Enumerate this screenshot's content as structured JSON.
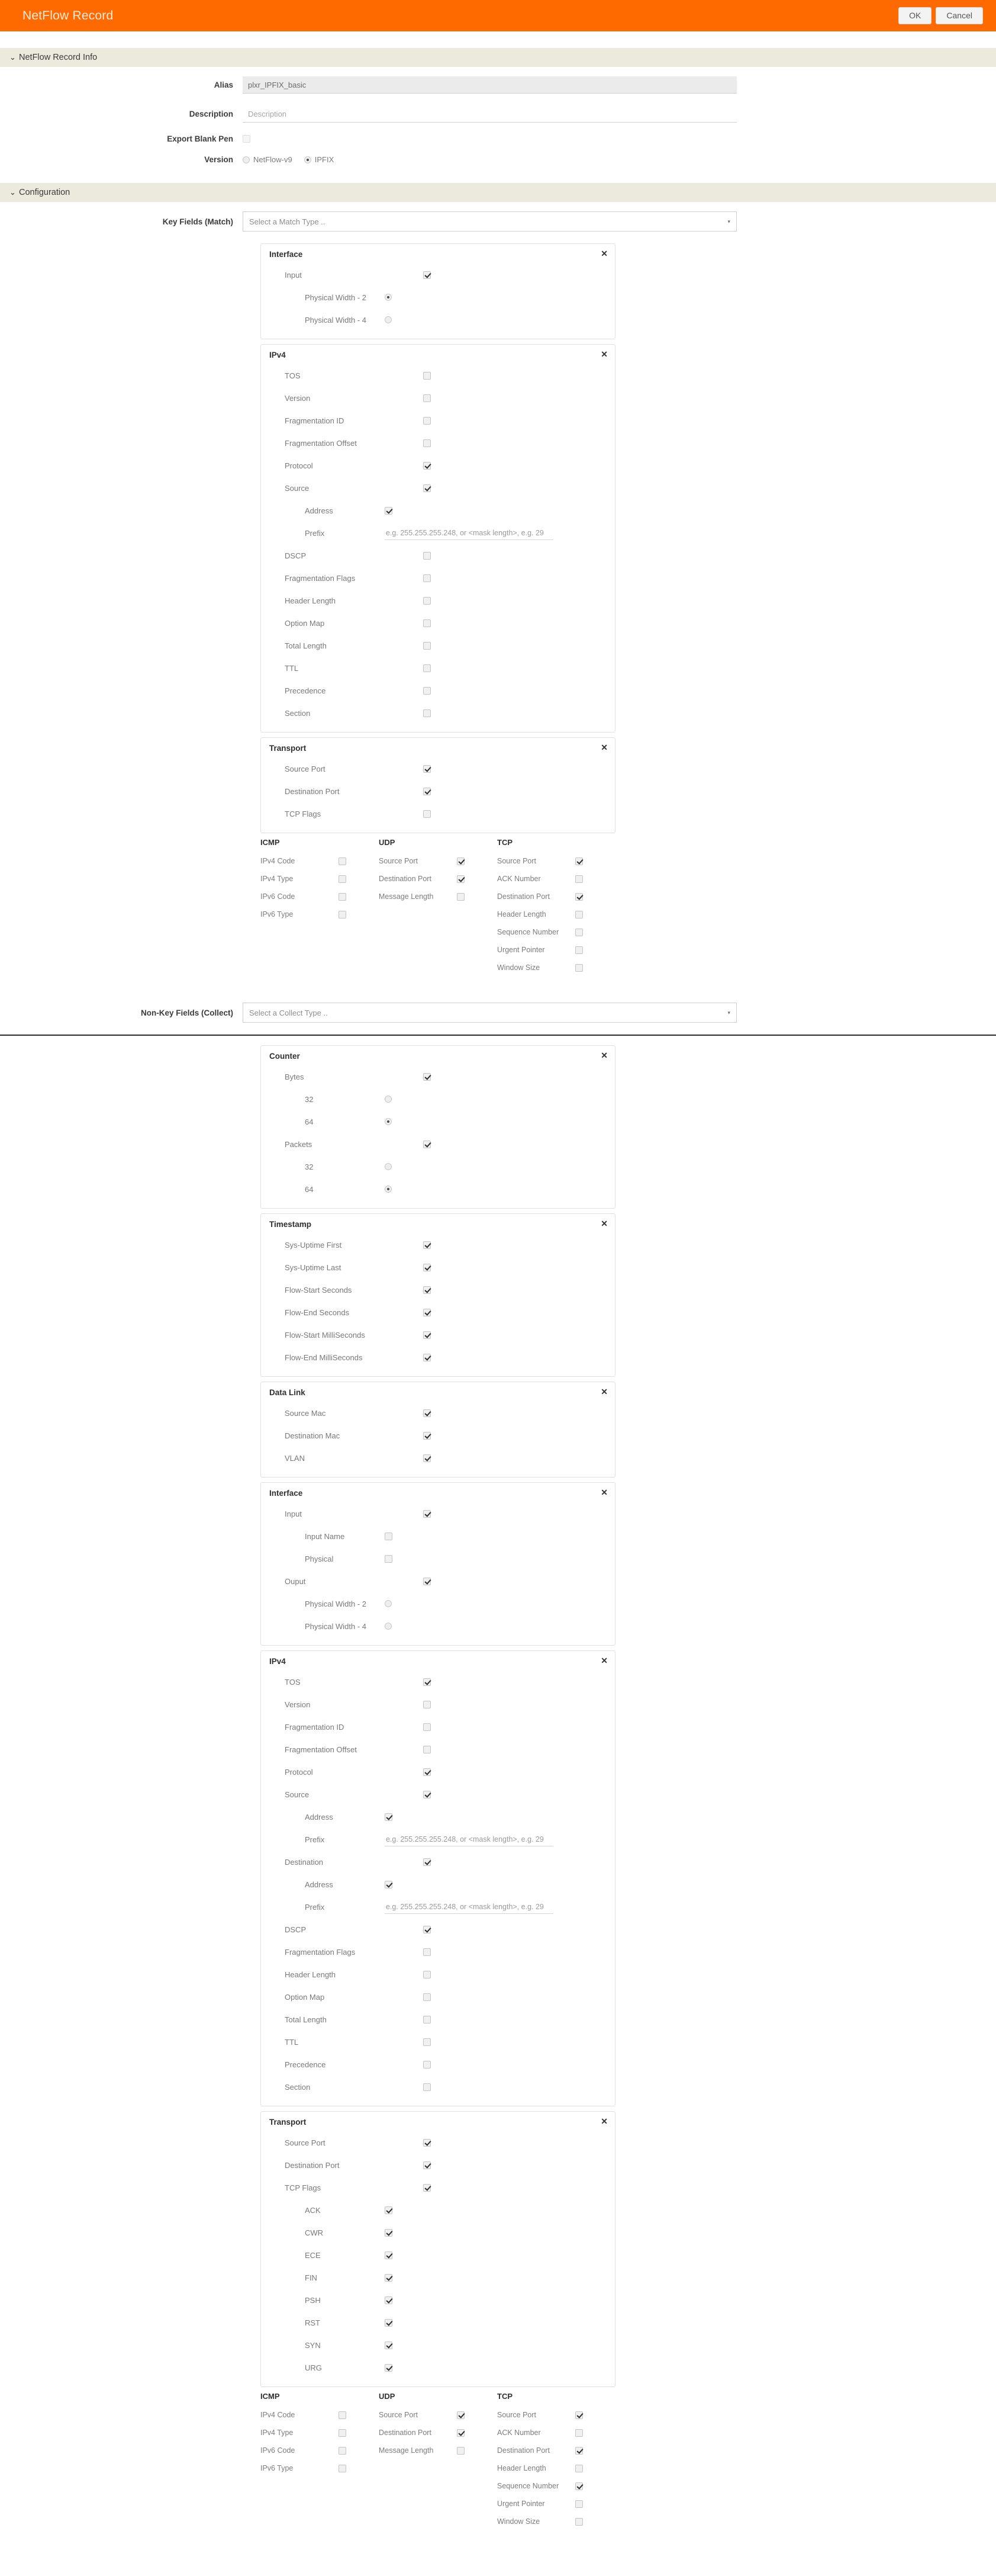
{
  "titlebar": {
    "title": "NetFlow Record",
    "ok_label": "OK",
    "cancel_label": "Cancel"
  },
  "sections": {
    "info": {
      "title": "NetFlow Record Info",
      "caret": "⌄"
    },
    "configuration": {
      "title": "Configuration",
      "caret": "⌄"
    }
  },
  "info_form": {
    "alias_label": "Alias",
    "alias_value": "plxr_IPFIX_basic",
    "description_label": "Description",
    "description_placeholder": "Description",
    "export_blank_pen_label": "Export Blank Pen",
    "export_blank_pen_checked": false,
    "version_label": "Version",
    "version_options": [
      {
        "label": "NetFlow-v9",
        "selected": false
      },
      {
        "label": "IPFIX",
        "selected": true
      }
    ]
  },
  "key_fields": {
    "label": "Key Fields (Match)",
    "select_placeholder": "Select a Match Type ..",
    "caret": "▾",
    "panels": [
      {
        "title": "Interface",
        "close": "✕",
        "rows": [
          {
            "label": "Input",
            "type": "checkbox",
            "checked": true,
            "level": 1
          },
          {
            "label": "Physical Width - 2",
            "type": "radio",
            "checked": true,
            "level": 2
          },
          {
            "label": "Physical Width - 4",
            "type": "radio",
            "checked": false,
            "level": 2
          }
        ]
      },
      {
        "title": "IPv4",
        "close": "✕",
        "rows": [
          {
            "label": "TOS",
            "type": "checkbox",
            "checked": false,
            "level": 1
          },
          {
            "label": "Version",
            "type": "checkbox",
            "checked": false,
            "level": 1
          },
          {
            "label": "Fragmentation ID",
            "type": "checkbox",
            "checked": false,
            "level": 1
          },
          {
            "label": "Fragmentation Offset",
            "type": "checkbox",
            "checked": false,
            "level": 1
          },
          {
            "label": "Protocol",
            "type": "checkbox",
            "checked": true,
            "level": 1
          },
          {
            "label": "Source",
            "type": "checkbox",
            "checked": true,
            "level": 1
          },
          {
            "label": "Address",
            "type": "checkbox",
            "checked": true,
            "level": 2
          },
          {
            "label": "Prefix",
            "type": "text",
            "placeholder": "e.g. 255.255.255.248, or <mask length>, e.g. 29",
            "level": 2
          },
          {
            "label": "DSCP",
            "type": "checkbox",
            "checked": false,
            "level": 1
          },
          {
            "label": "Fragmentation Flags",
            "type": "checkbox",
            "checked": false,
            "level": 1
          },
          {
            "label": "Header Length",
            "type": "checkbox",
            "checked": false,
            "level": 1
          },
          {
            "label": "Option Map",
            "type": "checkbox",
            "checked": false,
            "level": 1
          },
          {
            "label": "Total Length",
            "type": "checkbox",
            "checked": false,
            "level": 1
          },
          {
            "label": "TTL",
            "type": "checkbox",
            "checked": false,
            "level": 1
          },
          {
            "label": "Precedence",
            "type": "checkbox",
            "checked": false,
            "level": 1
          },
          {
            "label": "Section",
            "type": "checkbox",
            "checked": false,
            "level": 1
          }
        ]
      },
      {
        "title": "Transport",
        "close": "✕",
        "rows": [
          {
            "label": "Source Port",
            "type": "checkbox",
            "checked": true,
            "level": 1
          },
          {
            "label": "Destination Port",
            "type": "checkbox",
            "checked": true,
            "level": 1
          },
          {
            "label": "TCP Flags",
            "type": "checkbox",
            "checked": false,
            "level": 1
          }
        ]
      }
    ],
    "proto_columns": [
      {
        "title": "ICMP",
        "rows": [
          {
            "label": "IPv4 Code",
            "checked": false
          },
          {
            "label": "IPv4 Type",
            "checked": false
          },
          {
            "label": "IPv6 Code",
            "checked": false
          },
          {
            "label": "IPv6 Type",
            "checked": false
          }
        ]
      },
      {
        "title": "UDP",
        "rows": [
          {
            "label": "Source Port",
            "checked": true
          },
          {
            "label": "Destination Port",
            "checked": true
          },
          {
            "label": "Message Length",
            "checked": false
          }
        ]
      },
      {
        "title": "TCP",
        "rows": [
          {
            "label": "Source Port",
            "checked": true
          },
          {
            "label": "ACK Number",
            "checked": false
          },
          {
            "label": "Destination Port",
            "checked": true
          },
          {
            "label": "Header Length",
            "checked": false
          },
          {
            "label": "Sequence Number",
            "checked": false
          },
          {
            "label": "Urgent Pointer",
            "checked": false
          },
          {
            "label": "Window Size",
            "checked": false
          }
        ]
      }
    ]
  },
  "non_key_fields": {
    "label": "Non-Key Fields (Collect)",
    "select_placeholder": "Select a Collect Type ..",
    "caret": "▾",
    "panels": [
      {
        "title": "Counter",
        "close": "✕",
        "rows": [
          {
            "label": "Bytes",
            "type": "checkbox",
            "checked": true,
            "level": 1
          },
          {
            "label": "32",
            "type": "radio",
            "checked": false,
            "level": 2
          },
          {
            "label": "64",
            "type": "radio",
            "checked": true,
            "level": 2
          },
          {
            "label": "Packets",
            "type": "checkbox",
            "checked": true,
            "level": 1
          },
          {
            "label": "32",
            "type": "radio",
            "checked": false,
            "level": 2
          },
          {
            "label": "64",
            "type": "radio",
            "checked": true,
            "level": 2
          }
        ]
      },
      {
        "title": "Timestamp",
        "close": "✕",
        "rows": [
          {
            "label": "Sys-Uptime First",
            "type": "checkbox",
            "checked": true,
            "level": 1
          },
          {
            "label": "Sys-Uptime Last",
            "type": "checkbox",
            "checked": true,
            "level": 1
          },
          {
            "label": "Flow-Start Seconds",
            "type": "checkbox",
            "checked": true,
            "level": 1
          },
          {
            "label": "Flow-End Seconds",
            "type": "checkbox",
            "checked": true,
            "level": 1
          },
          {
            "label": "Flow-Start MilliSeconds",
            "type": "checkbox",
            "checked": true,
            "level": 1
          },
          {
            "label": "Flow-End MilliSeconds",
            "type": "checkbox",
            "checked": true,
            "level": 1
          }
        ]
      },
      {
        "title": "Data Link",
        "close": "✕",
        "rows": [
          {
            "label": "Source Mac",
            "type": "checkbox",
            "checked": true,
            "level": 1
          },
          {
            "label": "Destination Mac",
            "type": "checkbox",
            "checked": true,
            "level": 1
          },
          {
            "label": "VLAN",
            "type": "checkbox",
            "checked": true,
            "level": 1
          }
        ]
      },
      {
        "title": "Interface",
        "close": "✕",
        "rows": [
          {
            "label": "Input",
            "type": "checkbox",
            "checked": true,
            "level": 1
          },
          {
            "label": "Input Name",
            "type": "checkbox",
            "checked": false,
            "level": 2
          },
          {
            "label": "Physical",
            "type": "checkbox",
            "checked": false,
            "level": 2
          },
          {
            "label": "Ouput",
            "type": "checkbox",
            "checked": true,
            "level": 1
          },
          {
            "label": "Physical Width - 2",
            "type": "radio",
            "checked": false,
            "level": 2
          },
          {
            "label": "Physical Width - 4",
            "type": "radio",
            "checked": false,
            "level": 2
          }
        ]
      },
      {
        "title": "IPv4",
        "close": "✕",
        "rows": [
          {
            "label": "TOS",
            "type": "checkbox",
            "checked": true,
            "level": 1
          },
          {
            "label": "Version",
            "type": "checkbox",
            "checked": false,
            "level": 1
          },
          {
            "label": "Fragmentation ID",
            "type": "checkbox",
            "checked": false,
            "level": 1
          },
          {
            "label": "Fragmentation Offset",
            "type": "checkbox",
            "checked": false,
            "level": 1
          },
          {
            "label": "Protocol",
            "type": "checkbox",
            "checked": true,
            "level": 1
          },
          {
            "label": "Source",
            "type": "checkbox",
            "checked": true,
            "level": 1
          },
          {
            "label": "Address",
            "type": "checkbox",
            "checked": true,
            "level": 2
          },
          {
            "label": "Prefix",
            "type": "text",
            "placeholder": "e.g. 255.255.255.248, or <mask length>, e.g. 29",
            "level": 2
          },
          {
            "label": "Destination",
            "type": "checkbox",
            "checked": true,
            "level": 1
          },
          {
            "label": "Address",
            "type": "checkbox",
            "checked": true,
            "level": 2
          },
          {
            "label": "Prefix",
            "type": "text",
            "placeholder": "e.g. 255.255.255.248, or <mask length>, e.g. 29",
            "level": 2
          },
          {
            "label": "DSCP",
            "type": "checkbox",
            "checked": true,
            "level": 1
          },
          {
            "label": "Fragmentation Flags",
            "type": "checkbox",
            "checked": false,
            "level": 1
          },
          {
            "label": "Header Length",
            "type": "checkbox",
            "checked": false,
            "level": 1
          },
          {
            "label": "Option Map",
            "type": "checkbox",
            "checked": false,
            "level": 1
          },
          {
            "label": "Total Length",
            "type": "checkbox",
            "checked": false,
            "level": 1
          },
          {
            "label": "TTL",
            "type": "checkbox",
            "checked": false,
            "level": 1
          },
          {
            "label": "Precedence",
            "type": "checkbox",
            "checked": false,
            "level": 1
          },
          {
            "label": "Section",
            "type": "checkbox",
            "checked": false,
            "level": 1
          }
        ]
      },
      {
        "title": "Transport",
        "close": "✕",
        "rows": [
          {
            "label": "Source Port",
            "type": "checkbox",
            "checked": true,
            "level": 1
          },
          {
            "label": "Destination Port",
            "type": "checkbox",
            "checked": true,
            "level": 1
          },
          {
            "label": "TCP Flags",
            "type": "checkbox",
            "checked": true,
            "level": 1
          },
          {
            "label": "ACK",
            "type": "checkbox",
            "checked": true,
            "level": 2
          },
          {
            "label": "CWR",
            "type": "checkbox",
            "checked": true,
            "level": 2
          },
          {
            "label": "ECE",
            "type": "checkbox",
            "checked": true,
            "level": 2
          },
          {
            "label": "FIN",
            "type": "checkbox",
            "checked": true,
            "level": 2
          },
          {
            "label": "PSH",
            "type": "checkbox",
            "checked": true,
            "level": 2
          },
          {
            "label": "RST",
            "type": "checkbox",
            "checked": true,
            "level": 2
          },
          {
            "label": "SYN",
            "type": "checkbox",
            "checked": true,
            "level": 2
          },
          {
            "label": "URG",
            "type": "checkbox",
            "checked": true,
            "level": 2
          }
        ]
      }
    ],
    "proto_columns": [
      {
        "title": "ICMP",
        "rows": [
          {
            "label": "IPv4 Code",
            "checked": false
          },
          {
            "label": "IPv4 Type",
            "checked": false
          },
          {
            "label": "IPv6 Code",
            "checked": false
          },
          {
            "label": "IPv6 Type",
            "checked": false
          }
        ]
      },
      {
        "title": "UDP",
        "rows": [
          {
            "label": "Source Port",
            "checked": true
          },
          {
            "label": "Destination Port",
            "checked": true
          },
          {
            "label": "Message Length",
            "checked": false
          }
        ]
      },
      {
        "title": "TCP",
        "rows": [
          {
            "label": "Source Port",
            "checked": true
          },
          {
            "label": "ACK Number",
            "checked": false
          },
          {
            "label": "Destination Port",
            "checked": true
          },
          {
            "label": "Header Length",
            "checked": false
          },
          {
            "label": "Sequence Number",
            "checked": true
          },
          {
            "label": "Urgent Pointer",
            "checked": false
          },
          {
            "label": "Window Size",
            "checked": false
          }
        ]
      }
    ]
  },
  "colors": {
    "brand_orange": "#ff6a00",
    "section_header": "#eceadd",
    "title_text": "#ffe9d9"
  }
}
